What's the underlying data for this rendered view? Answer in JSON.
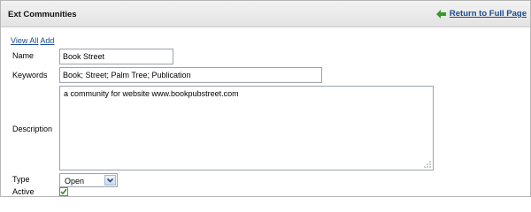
{
  "portlet": {
    "title": "Ext Communities",
    "return_link": "Return to Full Page"
  },
  "links": {
    "view_all": "View All",
    "add": "Add"
  },
  "form": {
    "name_label": "Name",
    "name_value": "Book Street",
    "keywords_label": "Keywords",
    "keywords_value": "Book; Street; Palm Tree; Publication",
    "description_label": "Description",
    "description_value": "a community for website www.bookpubstreet.com",
    "type_label": "Type",
    "type_value": "Open",
    "active_label": "Active",
    "active_checked": true
  },
  "colors": {
    "link": "#1a4c8f",
    "return_arrow": "#3a9a2a"
  },
  "icons": {
    "return": "return-arrow-icon",
    "dropdown": "chevron-down-icon",
    "check": "check-icon"
  }
}
